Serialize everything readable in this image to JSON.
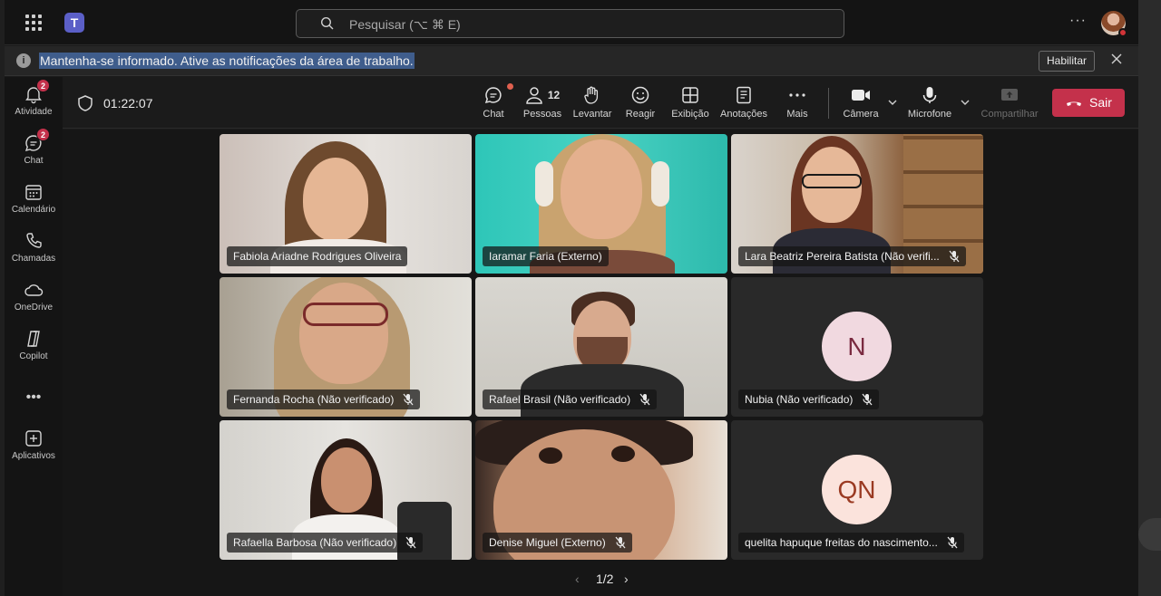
{
  "search": {
    "placeholder": "Pesquisar (⌥ ⌘ E)"
  },
  "notice": {
    "message": "Mantenha-se informado. Ative as notificações da área de trabalho.",
    "enable_label": "Habilitar"
  },
  "rail": {
    "items": [
      {
        "label": "Atividade",
        "icon": "bell-icon",
        "badge": "2"
      },
      {
        "label": "Chat",
        "icon": "chat-icon",
        "badge": "2"
      },
      {
        "label": "Calendário",
        "icon": "calendar-icon"
      },
      {
        "label": "Chamadas",
        "icon": "phone-icon"
      },
      {
        "label": "OneDrive",
        "icon": "cloud-icon"
      },
      {
        "label": "Copilot",
        "icon": "copilot-icon"
      },
      {
        "label": "Aplicativos",
        "icon": "add-apps-icon"
      }
    ],
    "more": "•••"
  },
  "meeting": {
    "timer": "01:22:07",
    "people_count": "12",
    "tools": {
      "chat": "Chat",
      "people": "Pessoas",
      "raise": "Levantar",
      "react": "Reagir",
      "view": "Exibição",
      "notes": "Anotações",
      "more": "Mais",
      "camera": "Câmera",
      "mic": "Microfone",
      "share": "Compartilhar"
    },
    "leave_label": "Sair"
  },
  "participants": [
    {
      "name": "Fabiola Ariadne Rodrigues Oliveira",
      "muted": false
    },
    {
      "name": "Iaramar Faria (Externo)",
      "muted": false
    },
    {
      "name": "Lara Beatriz Pereira Batista (Não verifi...",
      "muted": true
    },
    {
      "name": "Fernanda Rocha (Não verificado)",
      "muted": true
    },
    {
      "name": "Rafael Brasil (Não verificado)",
      "muted": true
    },
    {
      "name": "Nubia (Não verificado)",
      "muted": true,
      "initials": "N"
    },
    {
      "name": "Rafaella Barbosa (Não verificado)",
      "muted": true
    },
    {
      "name": "Denise Miguel (Externo)",
      "muted": true
    },
    {
      "name": "quelita hapuque freitas do nascimento...",
      "muted": true,
      "initials": "QN"
    }
  ],
  "pager": {
    "text": "1/2"
  },
  "colors": {
    "leave": "#c4314b",
    "accent": "#5b5fc7",
    "initials_bg": "#f1d9e0"
  }
}
